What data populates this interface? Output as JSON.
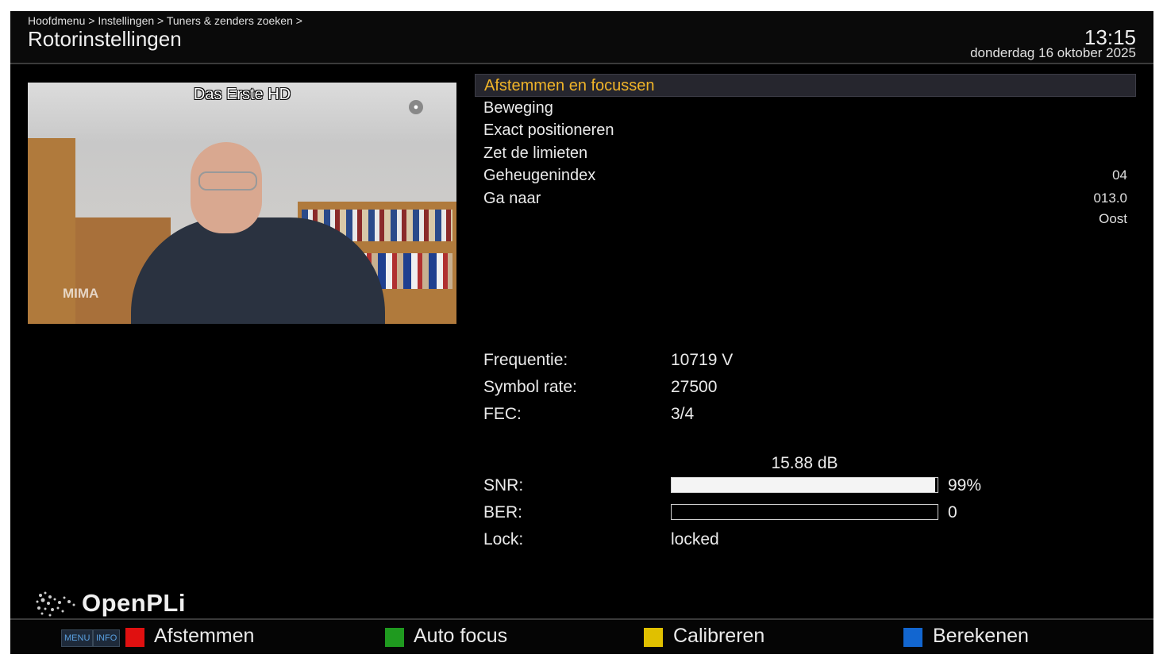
{
  "header": {
    "breadcrumb": "Hoofdmenu > Instellingen > Tuners & zenders zoeken >",
    "title": "Rotorinstellingen",
    "time": "13:15",
    "date": "donderdag 16 oktober 2025"
  },
  "video": {
    "channel": "Das Erste HD",
    "overlay_text": "MIMA"
  },
  "menu": {
    "items": [
      {
        "label": "Afstemmen en focussen",
        "value": "",
        "selected": true
      },
      {
        "label": "Beweging",
        "value": ""
      },
      {
        "label": "Exact positioneren",
        "value": ""
      },
      {
        "label": "Zet de limieten",
        "value": ""
      },
      {
        "label": "Geheugenindex",
        "value": "04"
      },
      {
        "label": "Ga naar",
        "value": "013.0"
      }
    ],
    "extra_value": "Oost"
  },
  "tuner": {
    "frequency_label": "Frequentie:",
    "frequency_value": "10719 V",
    "symbolrate_label": "Symbol rate:",
    "symbolrate_value": "27500",
    "fec_label": "FEC:",
    "fec_value": "3/4",
    "snr_db": "15.88 dB",
    "snr_label": "SNR:",
    "snr_percent": "99%",
    "snr_level": 0.99,
    "ber_label": "BER:",
    "ber_value": "0",
    "ber_level": 0,
    "lock_label": "Lock:",
    "lock_value": "locked"
  },
  "logo": {
    "text": "OpenPLi"
  },
  "footer": {
    "menu_tag": "MENU",
    "info_tag": "INFO",
    "red_label": "Afstemmen",
    "green_label": "Auto focus",
    "yellow_label": "Calibreren",
    "blue_label": "Berekenen"
  },
  "colors": {
    "red": "#e01010",
    "green": "#1f9a1f",
    "yellow": "#e0c000",
    "blue": "#1266d0",
    "highlight": "#f0b429"
  }
}
